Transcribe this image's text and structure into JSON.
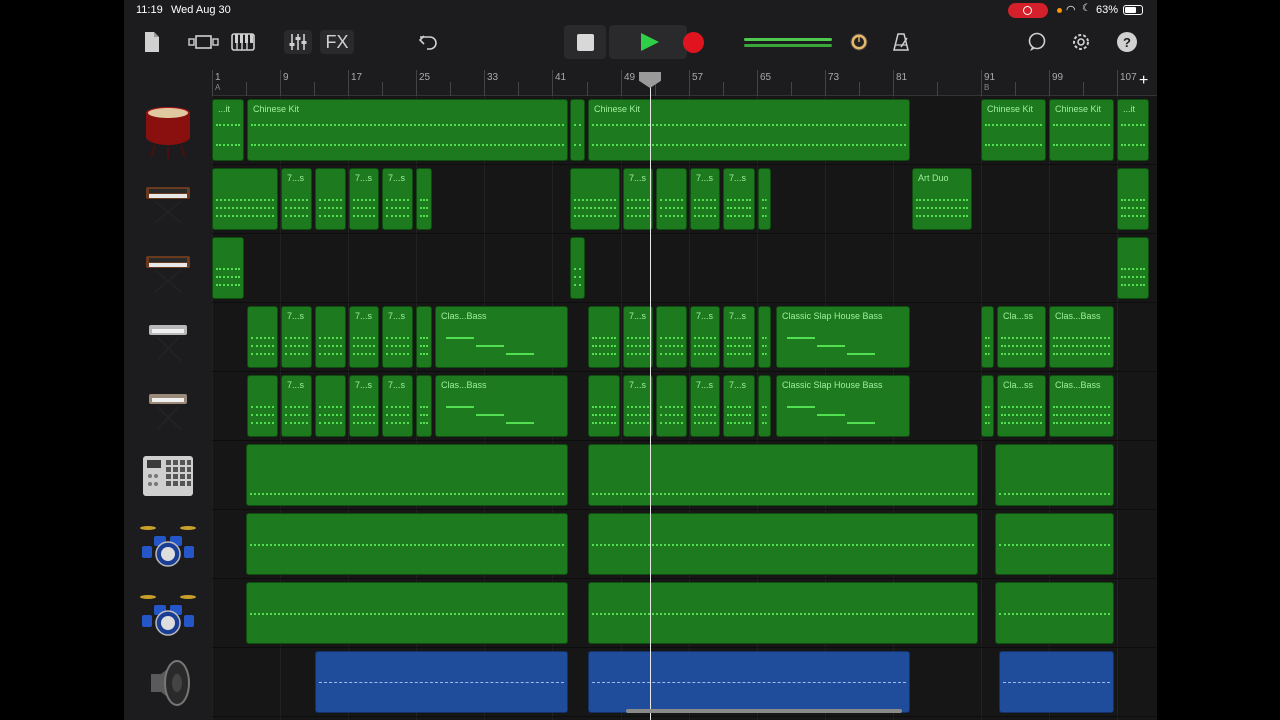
{
  "status": {
    "time": "11:19",
    "date": "Wed Aug 30",
    "battery": "63%"
  },
  "toolbar": {
    "fx_label": "FX"
  },
  "ruler": {
    "bars": [
      {
        "label": "1",
        "section": "A"
      },
      {
        "label": "9"
      },
      {
        "label": "17"
      },
      {
        "label": "25"
      },
      {
        "label": "33"
      },
      {
        "label": "41"
      },
      {
        "label": "49"
      },
      {
        "label": "57"
      },
      {
        "label": "65"
      },
      {
        "label": "73"
      },
      {
        "label": "81"
      },
      {
        "label": "91",
        "section": "B"
      },
      {
        "label": "99"
      },
      {
        "label": "107"
      }
    ]
  },
  "tracks": [
    {
      "name": "chinese-drum",
      "regions": [
        {
          "name": "...it"
        },
        {
          "name": "Chinese Kit"
        },
        {
          "name": ""
        },
        {
          "name": "Chinese Kit"
        },
        {
          "name": "Chinese Kit"
        },
        {
          "name": "Chinese Kit"
        },
        {
          "name": "...it"
        }
      ]
    },
    {
      "name": "synth-1",
      "regions": [
        {
          "name": ""
        },
        {
          "name": "7...s"
        },
        {
          "name": ""
        },
        {
          "name": "7...s"
        },
        {
          "name": "7...s"
        },
        {
          "name": ""
        },
        {
          "name": ""
        },
        {
          "name": "7...s"
        },
        {
          "name": ""
        },
        {
          "name": "7...s"
        },
        {
          "name": "7...s"
        },
        {
          "name": ""
        },
        {
          "name": "Art Duo"
        },
        {
          "name": ""
        }
      ]
    },
    {
      "name": "synth-2",
      "regions": [
        {
          "name": ""
        },
        {
          "name": ""
        },
        {
          "name": ""
        }
      ]
    },
    {
      "name": "keys-1",
      "regions": [
        {
          "name": ""
        },
        {
          "name": "7...s"
        },
        {
          "name": ""
        },
        {
          "name": "7...s"
        },
        {
          "name": "7...s"
        },
        {
          "name": ""
        },
        {
          "name": "Clas...Bass"
        },
        {
          "name": ""
        },
        {
          "name": "7...s"
        },
        {
          "name": ""
        },
        {
          "name": "7...s"
        },
        {
          "name": "7...s"
        },
        {
          "name": ""
        },
        {
          "name": "Classic Slap House Bass"
        },
        {
          "name": ""
        },
        {
          "name": "Cla...ss"
        },
        {
          "name": "Clas...Bass"
        }
      ]
    },
    {
      "name": "keys-2",
      "regions": [
        {
          "name": ""
        },
        {
          "name": "7...s"
        },
        {
          "name": ""
        },
        {
          "name": "7...s"
        },
        {
          "name": "7...s"
        },
        {
          "name": ""
        },
        {
          "name": "Clas...Bass"
        },
        {
          "name": ""
        },
        {
          "name": "7...s"
        },
        {
          "name": ""
        },
        {
          "name": "7...s"
        },
        {
          "name": "7...s"
        },
        {
          "name": ""
        },
        {
          "name": "Classic Slap House Bass"
        },
        {
          "name": ""
        },
        {
          "name": "Cla...ss"
        },
        {
          "name": "Clas...Bass"
        }
      ]
    },
    {
      "name": "beat-sequencer",
      "regions": [
        {
          "name": ""
        },
        {
          "name": ""
        },
        {
          "name": ""
        }
      ]
    },
    {
      "name": "drum-kit-1",
      "regions": [
        {
          "name": ""
        },
        {
          "name": ""
        },
        {
          "name": ""
        }
      ]
    },
    {
      "name": "drum-kit-2",
      "regions": [
        {
          "name": ""
        },
        {
          "name": ""
        },
        {
          "name": ""
        }
      ]
    },
    {
      "name": "audio-speaker",
      "regions": [
        {
          "name": ""
        },
        {
          "name": ""
        },
        {
          "name": ""
        }
      ]
    }
  ]
}
